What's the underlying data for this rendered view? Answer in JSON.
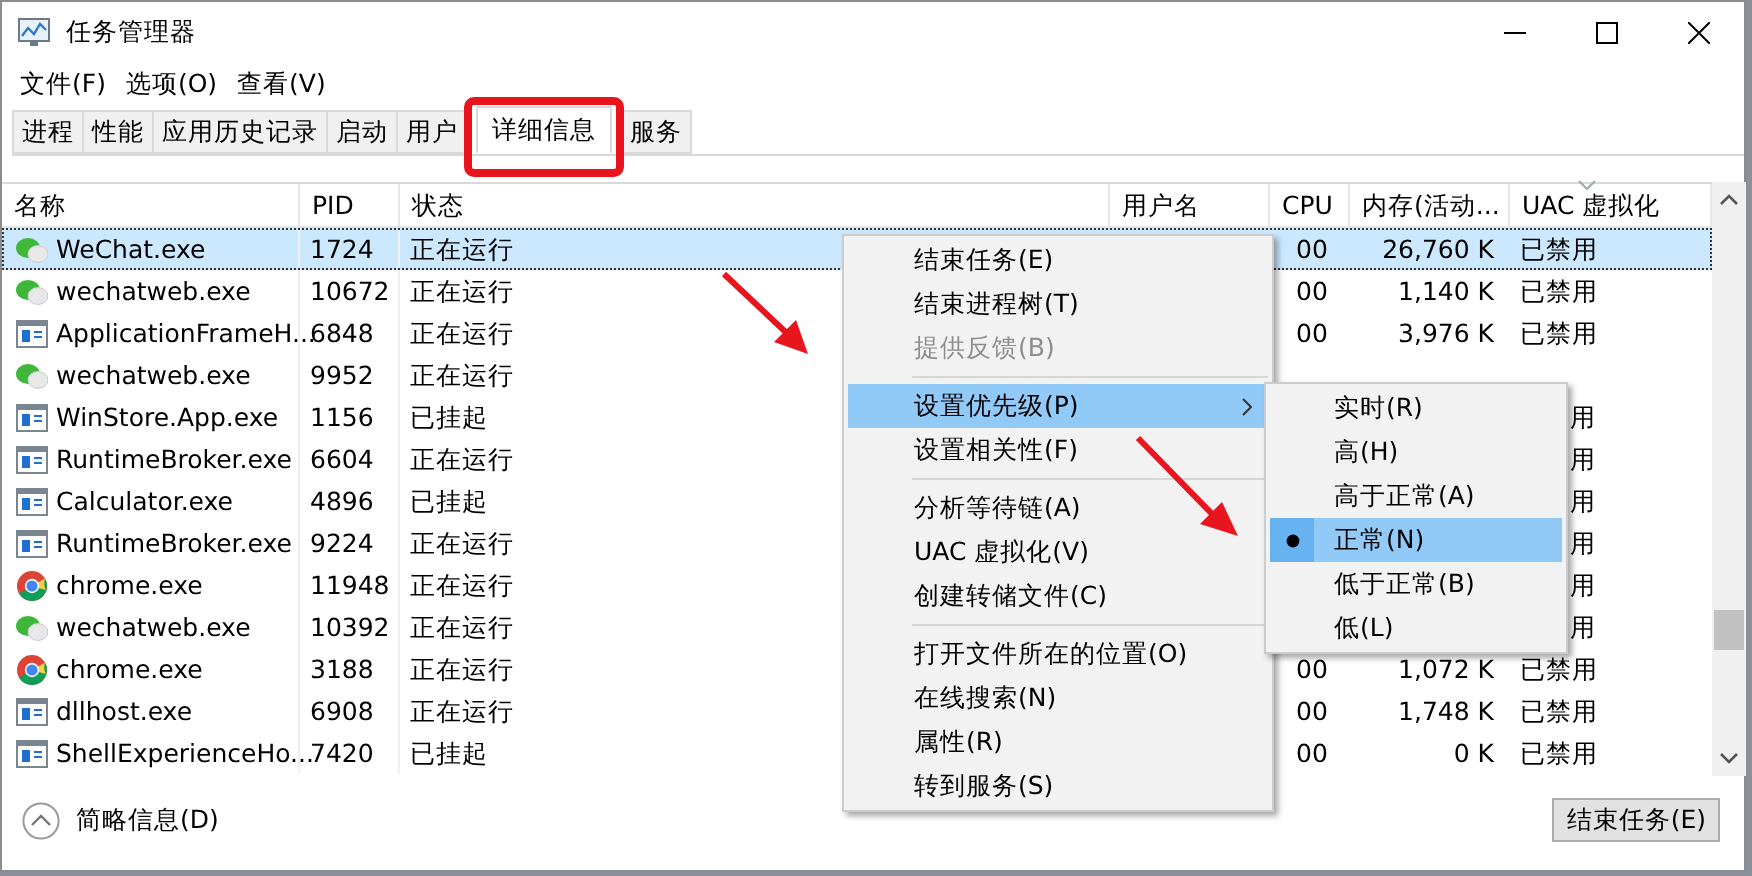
{
  "window": {
    "title": "任务管理器"
  },
  "menu_bar": [
    "文件(F)",
    "选项(O)",
    "查看(V)"
  ],
  "tabs": [
    {
      "label": "进程",
      "selected": false
    },
    {
      "label": "性能",
      "selected": false
    },
    {
      "label": "应用历史记录",
      "selected": false
    },
    {
      "label": "启动",
      "selected": false
    },
    {
      "label": "用户",
      "selected": false
    },
    {
      "label": "详细信息",
      "selected": true
    },
    {
      "label": "服务",
      "selected": false
    }
  ],
  "table": {
    "columns": [
      "名称",
      "PID",
      "状态",
      "用户名",
      "CPU",
      "内存(活动...",
      "UAC 虚拟化"
    ],
    "rows": [
      {
        "kind": "wechat",
        "selected": true,
        "name": "WeChat.exe",
        "pid": "1724",
        "status": "正在运行",
        "cpu": "00",
        "memory": "26,760 K",
        "uac": "已禁用",
        "uac_clipped": false
      },
      {
        "kind": "wechat",
        "selected": false,
        "name": "wechatweb.exe",
        "pid": "10672",
        "status": "正在运行",
        "cpu": "00",
        "memory": "1,140 K",
        "uac": "已禁用",
        "uac_clipped": false
      },
      {
        "kind": "window",
        "selected": false,
        "name": "ApplicationFrameH...",
        "pid": "6848",
        "status": "正在运行",
        "cpu": "00",
        "memory": "3,976 K",
        "uac": "已禁用",
        "uac_clipped": false
      },
      {
        "kind": "wechat",
        "selected": false,
        "name": "wechatweb.exe",
        "pid": "9952",
        "status": "正在运行"
      },
      {
        "kind": "window",
        "selected": false,
        "name": "WinStore.App.exe",
        "pid": "1156",
        "status": "已挂起",
        "uac": "用",
        "uac_clipped": true
      },
      {
        "kind": "window",
        "selected": false,
        "name": "RuntimeBroker.exe",
        "pid": "6604",
        "status": "正在运行",
        "uac": "用",
        "uac_clipped": true
      },
      {
        "kind": "window",
        "selected": false,
        "name": "Calculator.exe",
        "pid": "4896",
        "status": "已挂起",
        "uac": "用",
        "uac_clipped": true
      },
      {
        "kind": "window",
        "selected": false,
        "name": "RuntimeBroker.exe",
        "pid": "9224",
        "status": "正在运行",
        "uac": "用",
        "uac_clipped": true
      },
      {
        "kind": "chrome",
        "selected": false,
        "name": "chrome.exe",
        "pid": "11948",
        "status": "正在运行",
        "uac": "用",
        "uac_clipped": true
      },
      {
        "kind": "wechat",
        "selected": false,
        "name": "wechatweb.exe",
        "pid": "10392",
        "status": "正在运行",
        "uac": "用",
        "uac_clipped": true
      },
      {
        "kind": "chrome",
        "selected": false,
        "name": "chrome.exe",
        "pid": "3188",
        "status": "正在运行",
        "cpu": "00",
        "memory": "1,072 K",
        "uac": "已禁用",
        "uac_clipped": false
      },
      {
        "kind": "window",
        "selected": false,
        "name": "dllhost.exe",
        "pid": "6908",
        "status": "正在运行",
        "cpu": "00",
        "memory": "1,748 K",
        "uac": "已禁用",
        "uac_clipped": false
      },
      {
        "kind": "window",
        "selected": false,
        "name": "ShellExperienceHo...",
        "pid": "7420",
        "status": "已挂起",
        "cpu": "00",
        "memory": "0 K",
        "uac": "已禁用",
        "uac_clipped": false
      }
    ]
  },
  "context_menu": {
    "groups": [
      [
        {
          "label": "结束任务(E)",
          "disabled": false,
          "selected": false,
          "submenu": false
        },
        {
          "label": "结束进程树(T)",
          "disabled": false,
          "selected": false,
          "submenu": false
        },
        {
          "label": "提供反馈(B)",
          "disabled": true,
          "selected": false,
          "submenu": false
        }
      ],
      [
        {
          "label": "设置优先级(P)",
          "disabled": false,
          "selected": true,
          "submenu": true
        },
        {
          "label": "设置相关性(F)",
          "disabled": false,
          "selected": false,
          "submenu": false
        }
      ],
      [
        {
          "label": "分析等待链(A)",
          "disabled": false,
          "selected": false,
          "submenu": false
        },
        {
          "label": "UAC 虚拟化(V)",
          "disabled": false,
          "selected": false,
          "submenu": false
        },
        {
          "label": "创建转储文件(C)",
          "disabled": false,
          "selected": false,
          "submenu": false
        }
      ],
      [
        {
          "label": "打开文件所在的位置(O)",
          "disabled": false,
          "selected": false,
          "submenu": false
        },
        {
          "label": "在线搜索(N)",
          "disabled": false,
          "selected": false,
          "submenu": false
        },
        {
          "label": "属性(R)",
          "disabled": false,
          "selected": false,
          "submenu": false
        },
        {
          "label": "转到服务(S)",
          "disabled": false,
          "selected": false,
          "submenu": false
        }
      ]
    ]
  },
  "priority_submenu": [
    {
      "label": "实时(R)",
      "selected": false
    },
    {
      "label": "高(H)",
      "selected": false
    },
    {
      "label": "高于正常(A)",
      "selected": false
    },
    {
      "label": "正常(N)",
      "selected": true
    },
    {
      "label": "低于正常(B)",
      "selected": false
    },
    {
      "label": "低(L)",
      "selected": false
    }
  ],
  "footer": {
    "toggle": "简略信息(D)",
    "button": "结束任务(E)"
  }
}
